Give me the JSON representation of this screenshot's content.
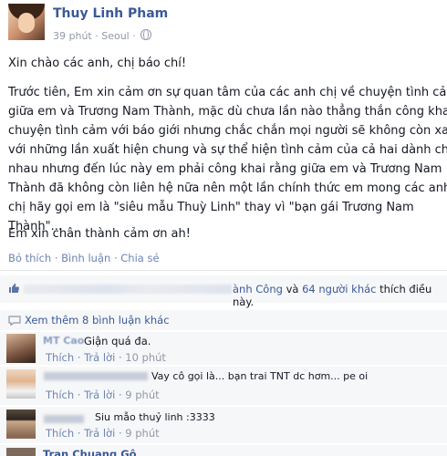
{
  "post": {
    "author": "Thuy Linh Pham",
    "time": "39 phút",
    "location": "Seoul",
    "paragraphs": [
      "Xin chào các anh, chị báo chí!",
      "Trước tiên, Em xin cảm ơn sự quan tâm của các anh chị về chuyện tình cảm",
      "giữa em và Trương Nam Thành, mặc dù chưa lần nào thẳng thắn công khai",
      "chuyện tình cảm với báo giới nhưng chắc chắn mọi người sẽ không còn xa lạ",
      "với những lần xuất hiện chung và sự thể hiện tình cảm của cả hai dành cho",
      "nhau nhưng đến lúc này em phải công khai rằng giữa em và Trương Nam",
      "Thành đã không còn liên hệ nữa nên một lần chính thức em mong các anh,",
      "chị hãy gọi em là \"siêu mẫu Thuỳ Linh\" thay vì \"bạn gái Trương Nam",
      "Thành\"...",
      "Em xin chân thành cảm ơn ah!"
    ],
    "actions": {
      "like": "Bỏ thích",
      "comment": "Bình luận",
      "share": "Chia sẻ"
    }
  },
  "likes": {
    "named": "ành Công",
    "and": "và",
    "others": "64 người khác",
    "suffix": "thích điều này."
  },
  "view_more": "Xem thêm 8 bình luận khác",
  "comments": [
    {
      "name": "MT Cao",
      "text": "Giận quá đa.",
      "like": "Thích",
      "reply": "Trả lời",
      "time": "10 phút"
    },
    {
      "name": "",
      "text": "Vay cô gọi là... bạn trai TNT dc hơm... pe oi",
      "like": "Thích",
      "reply": "Trả lời",
      "time": "9 phút"
    },
    {
      "name": "",
      "text": "Siu mẫo thuỷ linh :3333",
      "like": "Thích",
      "reply": "Trả lời",
      "time": "9 phút"
    },
    {
      "name": "Tran Chuang Gô",
      "text": "",
      "like": "",
      "reply": "",
      "time": ""
    }
  ],
  "colors": {
    "link": "#3b5998",
    "action": "#6d84b4",
    "meta": "#9197a3",
    "panel": "#f6f7f8"
  },
  "icons": [
    "globe-icon",
    "like-thumb-icon",
    "comment-bubble-icon"
  ]
}
